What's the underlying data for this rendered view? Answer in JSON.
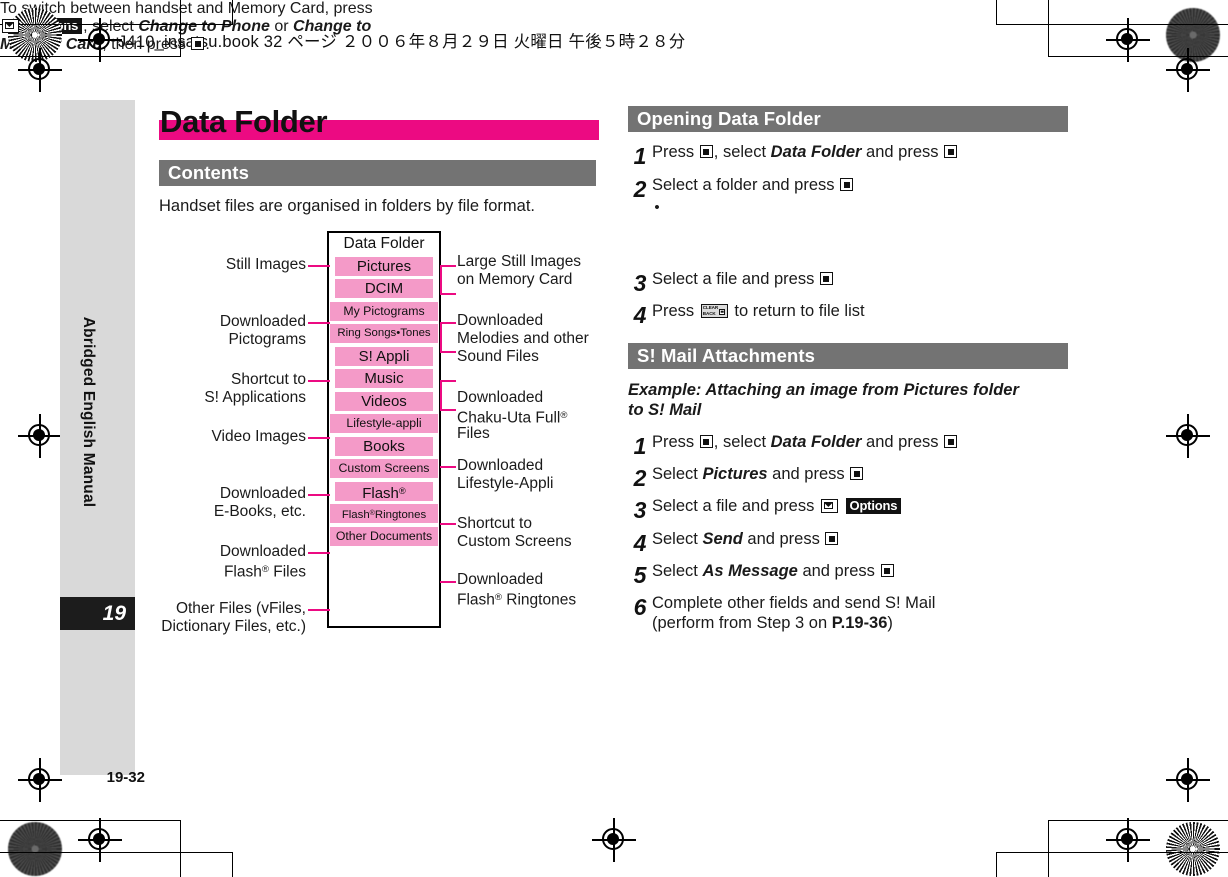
{
  "header": {
    "file_line": "J410_insatsu.book  32 ページ  ２００６年８月２９日   火曜日   午後５時２８分"
  },
  "sidebar": {
    "manual_label": "Abridged English Manual",
    "chapter_number": "19",
    "folio": "19-32"
  },
  "page": {
    "title": "Data Folder"
  },
  "contents": {
    "heading": "Contents",
    "intro": "Handset files are organised in folders by file format.",
    "diagram": {
      "root_label": "Data Folder",
      "folders": [
        "Pictures",
        "DCIM",
        "My Pictograms",
        "Ring Songs•Tones",
        "S! Appli",
        "Music",
        "Videos",
        "Lifestyle-appli",
        "Books",
        "Custom Screens",
        "Flash®",
        "Flash®Ringtones",
        "Other Documents"
      ],
      "left_labels": [
        "Still Images",
        "Downloaded\nPictograms",
        "Shortcut to\nS! Applications",
        "Video Images",
        "Downloaded\nE-Books, etc.",
        "Downloaded\nFlash® Files",
        "Other Files (vFiles,\nDictionary Files, etc.)"
      ],
      "left_label_1": "Still Images",
      "left_label_2a": "Downloaded",
      "left_label_2b": "Pictograms",
      "left_label_3a": "Shortcut to",
      "left_label_3b": "S! Applications",
      "left_label_4": "Video Images",
      "left_label_5a": "Downloaded",
      "left_label_5b": "E-Books, etc.",
      "left_label_6a": "Downloaded",
      "left_label_6b": "Flash® Files",
      "left_label_7a": "Other Files (vFiles,",
      "left_label_7b": "Dictionary Files, etc.)",
      "right_label_1a": "Large Still Images",
      "right_label_1b": "on Memory Card",
      "right_label_2a": "Downloaded",
      "right_label_2b": "Melodies and other",
      "right_label_2c": "Sound Files",
      "right_label_3a": "Downloaded",
      "right_label_3b": "Chaku-Uta Full®",
      "right_label_3c": "Files",
      "right_label_4a": "Downloaded",
      "right_label_4b": "Lifestyle-Appli",
      "right_label_5a": "Shortcut to",
      "right_label_5b": "Custom Screens",
      "right_label_6a": "Downloaded",
      "right_label_6b": "Flash® Ringtones"
    }
  },
  "opening": {
    "heading": "Opening Data Folder",
    "steps": [
      {
        "num": "1",
        "a": "Press",
        "b": ", select",
        "c": "Data Folder",
        "d": "and press"
      },
      {
        "num": "2",
        "a": "Select a folder and press"
      },
      {
        "num": "3",
        "a": "Select a file and press"
      },
      {
        "num": "4",
        "a": "Press",
        "b": "to return to file list"
      }
    ],
    "step2_note_1": "To switch between handset and Memory Card, press",
    "step2_note_2_options": "Options",
    "step2_note_2_a": ", select",
    "step2_note_2_b": "Change to Phone",
    "step2_note_2_c": "or",
    "step2_note_2_d": "Change to",
    "step2_note_3_a": "Memory Card",
    "step2_note_3_b": ", then press",
    "step2_note_3_c": "."
  },
  "smail": {
    "heading": "S! Mail Attachments",
    "example_line1": "Example: Attaching an image from Pictures folder",
    "example_line2": "to S! Mail",
    "steps": [
      {
        "num": "1",
        "a": "Press",
        "b": ", select",
        "c": "Data Folder",
        "d": "and press"
      },
      {
        "num": "2",
        "a": "Select",
        "c": "Pictures",
        "d": "and press"
      },
      {
        "num": "3",
        "a": "Select a file and press",
        "options": "Options"
      },
      {
        "num": "4",
        "a": "Select",
        "c": "Send",
        "d": "and press"
      },
      {
        "num": "5",
        "a": "Select",
        "c": "As Message",
        "d": "and press"
      },
      {
        "num": "6",
        "a": "Complete other fields and send S! Mail",
        "b1": "(perform from Step 3 on",
        "b2": "P.19-36",
        "b3": ")"
      }
    ]
  },
  "icons": {
    "center_key": "center-select-key",
    "clear_back_key": "clear-back-key",
    "mail_key": "mail-key",
    "clear_top": "CLEAR",
    "clear_bottom": "BACK"
  },
  "colors": {
    "magenta": "#ec0a82",
    "pink_row": "#f49ac8",
    "grey_header": "#737373",
    "sidebar_grey": "#d9d9d9",
    "chapter_black": "#1c1c1c"
  }
}
